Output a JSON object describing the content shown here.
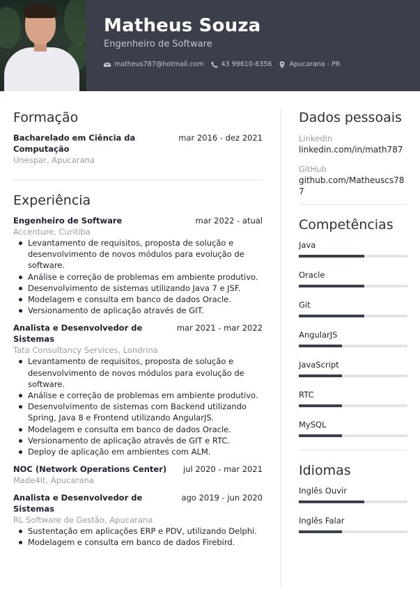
{
  "header": {
    "name": "Matheus Souza",
    "role": "Engenheiro de Software",
    "contacts": [
      {
        "icon": "envelope-icon",
        "text": "matheus787@hotmail.com"
      },
      {
        "icon": "phone-icon",
        "text": "43 99610-6356"
      },
      {
        "icon": "map-pin-icon",
        "text": "Apucarana - PR"
      }
    ]
  },
  "formacao": {
    "title": "Formação",
    "items": [
      {
        "title": "Bacharelado em Ciência da Computação",
        "date": "mar 2016 - dez 2021",
        "org": "Unespar, Apucarana"
      }
    ]
  },
  "experiencia": {
    "title": "Experiência",
    "items": [
      {
        "title": "Engenheiro de Software",
        "date": "mar 2022 - atual",
        "org": "Accenture, Curitiba",
        "bullets": [
          "Levantamento de requisitos, proposta de solução e desenvolvimento de novos módulos para evolução de software.",
          "Análise e correção de problemas em ambiente produtivo.",
          "Desenvolvimento de sistemas utilizando Java 7 e JSF.",
          "Modelagem e consulta em banco de dados Oracle.",
          "Versionamento de aplicação através de GIT."
        ]
      },
      {
        "title": "Analista e Desenvolvedor de Sistemas",
        "date": "mar 2021 - mar 2022",
        "org": "Tata Consultancy Services, Londrina",
        "bullets": [
          "Levantamento de requisitos, proposta de solução e desenvolvimento de novos módulos para evolução de software.",
          "Análise e correção de problemas em ambiente produtivo.",
          "Desenvolvimento de sistemas com Backend utilizando Spring, Java 8 e Frontend utilizando AngularJS.",
          "Modelagem e consulta em banco de dados Oracle.",
          "Versionamento de aplicação através de GIT e RTC.",
          "Deploy de aplicação em ambientes com ALM."
        ]
      },
      {
        "title": "NOC (Network Operations Center)",
        "date": "jul 2020 - mar 2021",
        "org": "Made4It, Apucarana",
        "bullets": []
      },
      {
        "title": "Analista e Desenvolvedor de Sistemas",
        "date": "ago 2019 - jun 2020",
        "org": "RL Software de Gestão, Apucarana",
        "bullets": [
          "Sustentação em aplicações ERP e PDV, utilizando Delphi.",
          "Modelagem e consulta em banco de dados Firebird."
        ]
      }
    ]
  },
  "dados": {
    "title": "Dados pessoais",
    "items": [
      {
        "label": "LinkedIn",
        "value": "linkedin.com/in/math787"
      },
      {
        "label": "GitHub",
        "value": "github.com/Matheuscs787"
      }
    ]
  },
  "competencias": {
    "title": "Competências",
    "items": [
      {
        "name": "Java",
        "level": 0.6
      },
      {
        "name": "Oracle",
        "level": 0.6
      },
      {
        "name": "Git",
        "level": 0.6
      },
      {
        "name": "AngularJS",
        "level": 0.4
      },
      {
        "name": "JavaScript",
        "level": 0.4
      },
      {
        "name": "RTC",
        "level": 0.4
      },
      {
        "name": "MySQL",
        "level": 0.4
      }
    ]
  },
  "idiomas": {
    "title": "Idiomas",
    "items": [
      {
        "name": "Inglês Ouvir",
        "level": 0.6
      },
      {
        "name": "Inglês Falar",
        "level": 0.4
      }
    ]
  }
}
